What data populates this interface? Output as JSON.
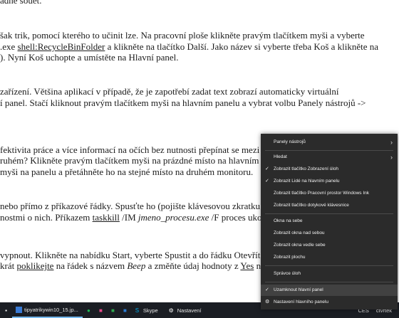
{
  "document": {
    "lines": [
      "šak trik, pomocí kterého to učinit lze. Na pracovní ploše klikněte pravým tlačítkem myši a vyberte",
      ".exe shell:RecycleBinFolder a klikněte na tlačítko Další. Jako název si vyberte třeba Koš a klikněte na",
      "). Nyní Koš uchopte a umístěte na Hlavní panel.",
      "zařízení. Většina aplikací v případě, že je zapotřebí zadat text zobrazí automaticky virtuální",
      "í panel. Stačí kliknout pravým tlačítkem myši na hlavním panelu a vybrat volbu Panely nástrojů ->",
      "fektivita práce a více informací na očích bez nutnosti přepínat se mezi o",
      "ruhém? Klikněte pravým tlačítkem myši na prázdné místo na hlavním pa",
      "myši na panelu a přetáhněte ho na stejné místo na druhém monitoru.",
      "nebo přímo z příkazové řádky. Spusťte ho (pojište klávesovou zkratku",
      "nostmi o nich. Příkazem taskkill /IM jmeno_procesu.exe /F proces uko",
      "vypnout. Klikněte na nabídku Start, vyberte Spustit a do řádku Otevřít",
      "krát poklikejte na řádek s názvem Beep a změňte údaj hodnoty z Yes na"
    ]
  },
  "taskbar": {
    "task_label": "tipyatrikywin10_15.jp...",
    "skype_label": "Skype",
    "settings_label": "Nastavení",
    "language": "CES",
    "time_partial": "čtvrtek"
  },
  "context_menu": {
    "items": [
      {
        "label": "Panely nástrojů",
        "checked": false,
        "submenu": true
      },
      {
        "label": "Hledat",
        "checked": false,
        "submenu": true
      },
      {
        "label": "Zobrazit tlačítko Zobrazení úloh",
        "checked": true,
        "submenu": false
      },
      {
        "label": "Zobrazit Lidé na hlavním panelu",
        "checked": true,
        "submenu": false
      },
      {
        "label": "Zobrazit tlačítko Pracovní prostor Windows Ink",
        "checked": false,
        "submenu": false
      },
      {
        "label": "Zobrazit tlačítko dotykové klávesnice",
        "checked": false,
        "submenu": false
      },
      {
        "label": "Okna na sebe",
        "checked": false,
        "submenu": false
      },
      {
        "label": "Zobrazit okna nad sebou",
        "checked": false,
        "submenu": false
      },
      {
        "label": "Zobrazit okna vedle sebe",
        "checked": false,
        "submenu": false
      },
      {
        "label": "Zobrazit plochu",
        "checked": false,
        "submenu": false
      },
      {
        "label": "Správce úloh",
        "checked": false,
        "submenu": false
      },
      {
        "label": "Uzamknout hlavní panel",
        "checked": true,
        "submenu": false
      },
      {
        "label": "Nastavení hlavního panelu",
        "checked": false,
        "submenu": false
      }
    ]
  },
  "colors": {
    "menu_bg": "#2b2b2b",
    "menu_highlight": "#414141",
    "taskbar_bg": "#1b1e24",
    "task_underline": "#76b9ed"
  }
}
